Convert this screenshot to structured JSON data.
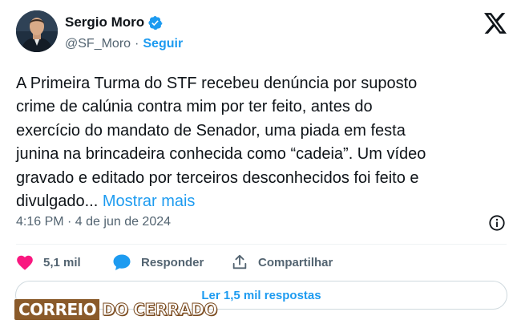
{
  "author": {
    "name": "Sergio Moro",
    "handle": "@SF_Moro",
    "separator": "·",
    "follow_label": "Seguir",
    "verified_icon": "verified-badge-icon",
    "avatar_desc": "profile photo"
  },
  "platform_logo": "x-logo-icon",
  "tweet": {
    "lines": [
      "A Primeira Turma do STF recebeu denúncia por suposto",
      "crime de calúnia contra mim por ter feito, antes do",
      "exercício do mandato de Senador, uma piada em festa",
      "junina na brincadeira conhecida como “cadeia”. Um vídeo",
      "gravado e editado por terceiros desconhecidos foi feito e",
      "divulgado... "
    ],
    "show_more_label": "Mostrar mais",
    "timestamp": "4:16 PM · 4 de jun de 2024"
  },
  "actions": {
    "likes": "5,1 mil",
    "reply_label": "Responder",
    "share_label": "Compartilhar"
  },
  "read_replies_label": "Ler 1,5 mil respostas",
  "watermark": {
    "part1": "CORREIO",
    "part2": "DO CERRADO"
  },
  "colors": {
    "accent": "#1d9bf0",
    "text": "#0f1419",
    "secondary": "#536471",
    "like": "#f91880",
    "border": "#cfd9de",
    "watermark_brown": "#8a5a2a"
  }
}
